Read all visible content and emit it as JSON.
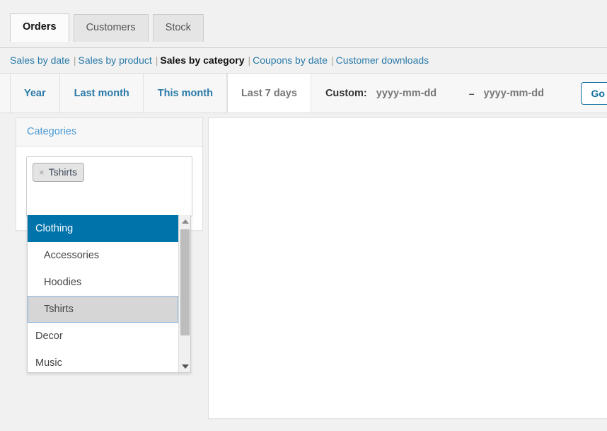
{
  "tabs": [
    {
      "label": "Orders",
      "active": true
    },
    {
      "label": "Customers",
      "active": false
    },
    {
      "label": "Stock",
      "active": false
    }
  ],
  "subnav": {
    "separator": "|",
    "links": [
      {
        "label": "Sales by date",
        "current": false
      },
      {
        "label": "Sales by product",
        "current": false
      },
      {
        "label": "Sales by category",
        "current": true
      },
      {
        "label": "Coupons by date",
        "current": false
      },
      {
        "label": "Customer downloads",
        "current": false
      }
    ]
  },
  "range": {
    "tabs": [
      {
        "label": "Year",
        "active": false
      },
      {
        "label": "Last month",
        "active": false
      },
      {
        "label": "This month",
        "active": false
      },
      {
        "label": "Last 7 days",
        "active": true
      }
    ],
    "custom_label": "Custom:",
    "from_placeholder": "yyyy-mm-dd",
    "from_value": "",
    "to_placeholder": "yyyy-mm-dd",
    "to_value": "",
    "dash": "–",
    "go_label": "Go"
  },
  "categories_panel": {
    "title": "Categories",
    "selected": [
      {
        "label": "Tshirts",
        "remove_icon": "close-x-icon",
        "remove_glyph": "×"
      }
    ],
    "dropdown": {
      "options": [
        {
          "label": "Clothing",
          "level": 0,
          "state": "highlighted"
        },
        {
          "label": "Accessories",
          "level": 1,
          "state": "normal"
        },
        {
          "label": "Hoodies",
          "level": 1,
          "state": "normal"
        },
        {
          "label": "Tshirts",
          "level": 1,
          "state": "selected"
        },
        {
          "label": "Decor",
          "level": 0,
          "state": "normal"
        },
        {
          "label": "Music",
          "level": 0,
          "state": "normal"
        }
      ],
      "scroll_up_icon": "triangle-up-icon",
      "scroll_down_icon": "triangle-down-icon"
    }
  },
  "colors": {
    "accent_blue": "#0073aa",
    "link_blue": "#2a7aa8",
    "page_bg": "#f1f1f1",
    "selected_gray": "#d6d6d6"
  }
}
